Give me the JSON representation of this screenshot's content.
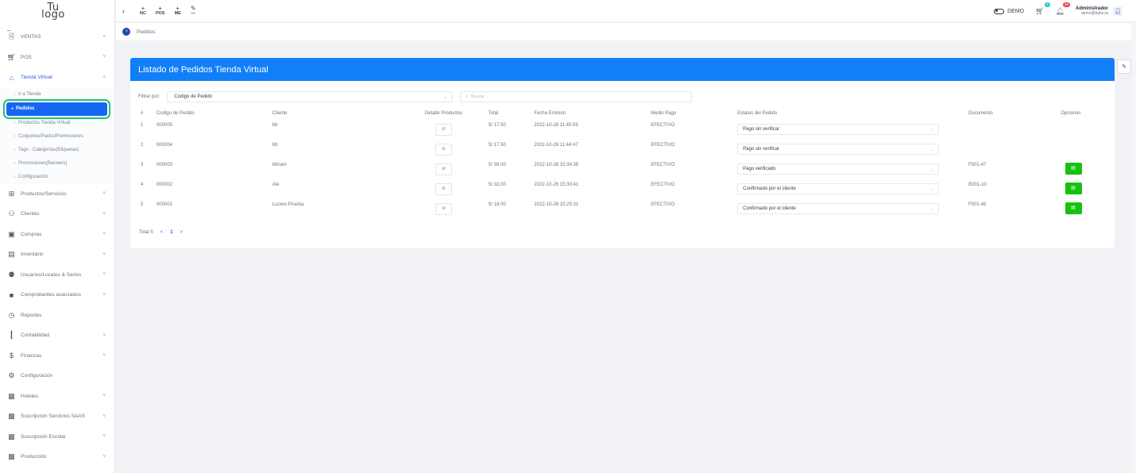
{
  "logo": {
    "line1": "Tu",
    "line2": "logo"
  },
  "sidebar": {
    "items": [
      {
        "label": "VENTAS",
        "icon": "document-icon",
        "expandable": true
      },
      {
        "label": "POS",
        "icon": "cart-icon",
        "expandable": true
      },
      {
        "label": "Tienda Virtual",
        "icon": "store-icon",
        "expandable": true,
        "open": true,
        "subitems": [
          {
            "label": "Ir a Tienda",
            "active": false
          },
          {
            "label": "Pedidos",
            "active": true
          },
          {
            "label": "Productos Tienda Virtual",
            "active": false
          },
          {
            "label": "Conjuntos/Packs/Promociones",
            "active": false
          },
          {
            "label": "Tags - Categorías(Etiquetas)",
            "active": false
          },
          {
            "label": "Promociones(Banners)",
            "active": false
          },
          {
            "label": "Configuración",
            "active": false
          }
        ]
      },
      {
        "label": "Productos/Servicios",
        "icon": "grid-icon",
        "expandable": true
      },
      {
        "label": "Clientes",
        "icon": "users-icon",
        "expandable": true
      },
      {
        "label": "Compras",
        "icon": "bag-icon",
        "expandable": true
      },
      {
        "label": "Inventario",
        "icon": "box-icon",
        "expandable": true
      },
      {
        "label": "Usuarios/Locales & Series",
        "icon": "group-icon",
        "expandable": true
      },
      {
        "label": "Comprobantes avanzados",
        "icon": "receipt-icon",
        "expandable": true
      },
      {
        "label": "Reportes",
        "icon": "pie-icon",
        "expandable": false
      },
      {
        "label": "Contabilidad",
        "icon": "bars-icon",
        "expandable": true
      },
      {
        "label": "Finanzas",
        "icon": "dollar-icon",
        "expandable": true
      },
      {
        "label": "Configuración",
        "icon": "gear-icon",
        "expandable": false
      },
      {
        "label": "Hoteles",
        "icon": "building-icon",
        "expandable": true
      },
      {
        "label": "Suscripción Servicios SAAS",
        "icon": "calendar-icon",
        "expandable": true
      },
      {
        "label": "Suscripción Escolar",
        "icon": "calendar-icon",
        "expandable": true
      },
      {
        "label": "Producción",
        "icon": "calendar-icon",
        "expandable": true
      }
    ]
  },
  "topbar": {
    "back": "‹",
    "buttons": [
      {
        "plus": "+",
        "label": "NC"
      },
      {
        "plus": "+",
        "label": "POS"
      },
      {
        "plus": "+",
        "label": "ME"
      },
      {
        "plus": "✎",
        "label": "—"
      }
    ],
    "demo_label": "DEMO",
    "cart_badge": "0",
    "bell_badge": "36",
    "admin_name": "Administrador",
    "admin_email": "demo@buho.la"
  },
  "breadcrumb": {
    "label": "Pedidos"
  },
  "card": {
    "title": "Listado de Pedidos Tienda Virtual",
    "filter_label": "Filtrar por:",
    "filter_value": "Codigo de Pedido",
    "search_placeholder": "Buscar",
    "columns": [
      "#",
      "Codigo de Pedido",
      "Cliente",
      "Detalle Productos",
      "Total",
      "Fecha Emision",
      "Medio Pago",
      "Estatus del Pedido",
      "Documento",
      "Opciones"
    ],
    "rows": [
      {
        "num": "1",
        "code": "000005",
        "client": "Mr",
        "total": "S/ 17.50",
        "fecha": "2022-10-28 11:45:59",
        "medio": "EFECTIVO",
        "status": "Pago sin verificar",
        "doc": "",
        "has_option": false
      },
      {
        "num": "2",
        "code": "000004",
        "client": "Mr",
        "total": "S/ 17.50",
        "fecha": "2022-10-28 11:44:47",
        "medio": "EFECTIVO",
        "status": "Pago sin verificar",
        "doc": "",
        "has_option": false
      },
      {
        "num": "3",
        "code": "000003",
        "client": "Miriam",
        "total": "S/ 59.00",
        "fecha": "2022-10-26 15:34:35",
        "medio": "EFECTIVO",
        "status": "Pago verificado",
        "doc": "F001-47",
        "has_option": true
      },
      {
        "num": "4",
        "code": "000002",
        "client": "Ale",
        "total": "S/ 32.00",
        "fecha": "2022-10-26 15:30:41",
        "medio": "EFECTIVO",
        "status": "Confirmado por el cliente",
        "doc": "B001-10",
        "has_option": true
      },
      {
        "num": "5",
        "code": "000001",
        "client": "Lucero Prueba",
        "total": "S/ 16.00",
        "fecha": "2022-10-26 15:25:31",
        "medio": "EFECTIVO",
        "status": "Confirmado por el cliente",
        "doc": "F001-46",
        "has_option": true
      }
    ],
    "pagination": {
      "total_label": "Total 5",
      "prev": "<",
      "current": "1",
      "next": ">"
    }
  },
  "colors": {
    "primary": "#117ff8",
    "active_menu": "#1667f2",
    "success": "#16c20e",
    "highlight_ring": "#18c47a"
  }
}
